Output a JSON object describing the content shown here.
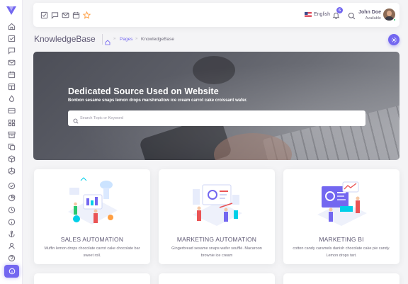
{
  "navbar": {
    "language": "English",
    "notification_count": "6",
    "user_name": "John Doe",
    "user_status": "Available"
  },
  "breadcrumb": {
    "page_title": "KnowledgeBase",
    "link": "Pages",
    "current": "KnowledgeBase"
  },
  "hero": {
    "title": "Dedicated Source Used on Website",
    "subtitle": "Bonbon sesame snaps lemon drops marshmallow ice cream carrot cake croissant wafer.",
    "search_placeholder": "Search Topic or Keyword"
  },
  "cards": [
    {
      "title": "SALES AUTOMATION",
      "description": "Muffin lemon drops chocolate carrot cake chocolate bar sweet roll."
    },
    {
      "title": "MARKETING AUTOMATION",
      "description": "Gingerbread sesame snaps wafer soufflé. Macaroon brownie ice cream"
    },
    {
      "title": "MARKETING BI",
      "description": "cotton candy caramels danish chocolate cake pie candy. Lemon drops tart."
    }
  ],
  "colors": {
    "primary": "#7367f0",
    "body_text": "#5e5873",
    "muted": "#6e6b7b",
    "background": "#f4f4f6",
    "star": "#ff9f43"
  },
  "sidebar_icons": [
    "home-icon",
    "checkbox-icon",
    "message-icon",
    "mail-icon",
    "calendar-icon",
    "kanban-icon",
    "droplet-icon",
    "credit-card-icon",
    "grid-icon",
    "archive-icon",
    "copy-icon",
    "box-icon",
    "layers-icon",
    "check-circle-icon",
    "pie-chart-icon",
    "clock-icon",
    "info-icon",
    "anchor-icon",
    "user-icon",
    "help-icon",
    "info-active-icon"
  ]
}
